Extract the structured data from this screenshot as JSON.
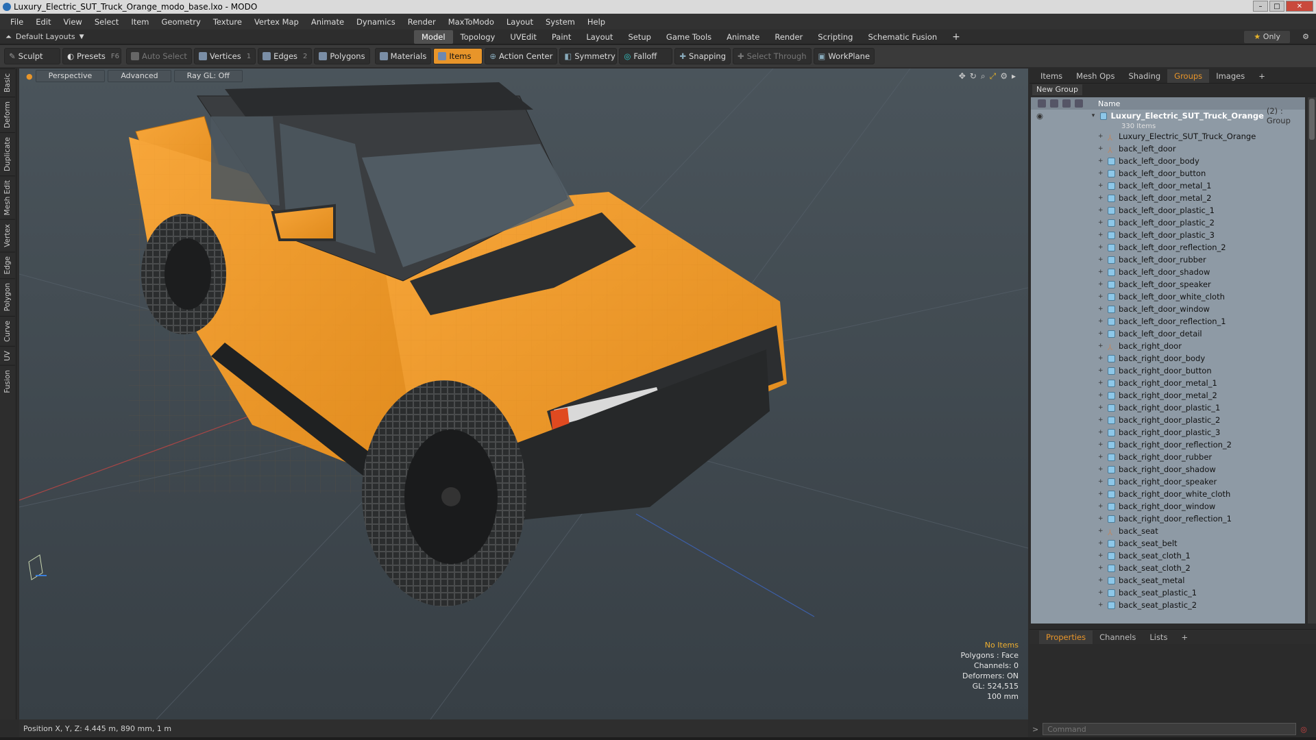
{
  "window": {
    "title": "Luxury_Electric_SUT_Truck_Orange_modo_base.lxo - MODO"
  },
  "menu": [
    "File",
    "Edit",
    "View",
    "Select",
    "Item",
    "Geometry",
    "Texture",
    "Vertex Map",
    "Animate",
    "Dynamics",
    "Render",
    "MaxToModo",
    "Layout",
    "System",
    "Help"
  ],
  "layout": {
    "selector": "Default Layouts",
    "tabs": [
      "Model",
      "Topology",
      "UVEdit",
      "Paint",
      "Layout",
      "Setup",
      "Game Tools",
      "Animate",
      "Render",
      "Scripting",
      "Schematic Fusion"
    ],
    "active_tab": "Model",
    "only_label": "Only"
  },
  "toolbar": {
    "sculpt": "Sculpt",
    "presets": "Presets",
    "presets_key": "F6",
    "auto_select": "Auto Select",
    "vertices": "Vertices",
    "vertices_key": "1",
    "edges": "Edges",
    "edges_key": "2",
    "polygons": "Polygons",
    "materials": "Materials",
    "items": "Items",
    "action_center": "Action Center",
    "symmetry": "Symmetry",
    "falloff": "Falloff",
    "snapping": "Snapping",
    "select_through": "Select Through",
    "workplane": "WorkPlane"
  },
  "left_tabs": [
    "Basic",
    "Deform",
    "Duplicate",
    "Mesh Edit",
    "Vertex",
    "Edge",
    "Polygon",
    "Curve",
    "UV",
    "Fusion"
  ],
  "viewport": {
    "view": "Perspective",
    "mode": "Advanced",
    "raygl": "Ray GL: Off",
    "stats": {
      "no_items": "No Items",
      "polygons": "Polygons : Face",
      "channels": "Channels: 0",
      "deformers": "Deformers: ON",
      "gl": "GL: 524,515",
      "scale": "100 mm"
    },
    "position": "Position X, Y, Z:   4.445 m, 890 mm, 1 m"
  },
  "right_panel": {
    "tabs": [
      "Items",
      "Mesh Ops",
      "Shading",
      "Groups",
      "Images"
    ],
    "active_tab": "Groups",
    "new_group": "New Group",
    "name_header": "Name",
    "root": {
      "name": "Luxury_Electric_SUT_Truck_Orange",
      "suffix": "(2) : Group",
      "count": "330 Items"
    },
    "items": [
      {
        "name": "Luxury_Electric_SUT_Truck_Orange",
        "kind": "locator"
      },
      {
        "name": "back_left_door",
        "kind": "locator"
      },
      {
        "name": "back_left_door_body",
        "kind": "mesh"
      },
      {
        "name": "back_left_door_button",
        "kind": "mesh"
      },
      {
        "name": "back_left_door_metal_1",
        "kind": "mesh"
      },
      {
        "name": "back_left_door_metal_2",
        "kind": "mesh"
      },
      {
        "name": "back_left_door_plastic_1",
        "kind": "mesh"
      },
      {
        "name": "back_left_door_plastic_2",
        "kind": "mesh"
      },
      {
        "name": "back_left_door_plastic_3",
        "kind": "mesh"
      },
      {
        "name": "back_left_door_reflection_2",
        "kind": "mesh"
      },
      {
        "name": "back_left_door_rubber",
        "kind": "mesh"
      },
      {
        "name": "back_left_door_shadow",
        "kind": "mesh"
      },
      {
        "name": "back_left_door_speaker",
        "kind": "mesh"
      },
      {
        "name": "back_left_door_white_cloth",
        "kind": "mesh"
      },
      {
        "name": "back_left_door_window",
        "kind": "mesh"
      },
      {
        "name": "back_left_door_reflection_1",
        "kind": "mesh"
      },
      {
        "name": "back_left_door_detail",
        "kind": "mesh"
      },
      {
        "name": "back_right_door",
        "kind": "locator"
      },
      {
        "name": "back_right_door_body",
        "kind": "mesh"
      },
      {
        "name": "back_right_door_button",
        "kind": "mesh"
      },
      {
        "name": "back_right_door_metal_1",
        "kind": "mesh"
      },
      {
        "name": "back_right_door_metal_2",
        "kind": "mesh"
      },
      {
        "name": "back_right_door_plastic_1",
        "kind": "mesh"
      },
      {
        "name": "back_right_door_plastic_2",
        "kind": "mesh"
      },
      {
        "name": "back_right_door_plastic_3",
        "kind": "mesh"
      },
      {
        "name": "back_right_door_reflection_2",
        "kind": "mesh"
      },
      {
        "name": "back_right_door_rubber",
        "kind": "mesh"
      },
      {
        "name": "back_right_door_shadow",
        "kind": "mesh"
      },
      {
        "name": "back_right_door_speaker",
        "kind": "mesh"
      },
      {
        "name": "back_right_door_white_cloth",
        "kind": "mesh"
      },
      {
        "name": "back_right_door_window",
        "kind": "mesh"
      },
      {
        "name": "back_right_door_reflection_1",
        "kind": "mesh"
      },
      {
        "name": "back_seat",
        "kind": "locator"
      },
      {
        "name": "back_seat_belt",
        "kind": "mesh"
      },
      {
        "name": "back_seat_cloth_1",
        "kind": "mesh"
      },
      {
        "name": "back_seat_cloth_2",
        "kind": "mesh"
      },
      {
        "name": "back_seat_metal",
        "kind": "mesh"
      },
      {
        "name": "back_seat_plastic_1",
        "kind": "mesh"
      },
      {
        "name": "back_seat_plastic_2",
        "kind": "mesh"
      }
    ],
    "bottom_tabs": [
      "Properties",
      "Channels",
      "Lists"
    ],
    "bottom_active": "Properties",
    "command_placeholder": "Command"
  },
  "colors": {
    "accent": "#e8952a",
    "truck": "#f29a2a",
    "viewport": "#3e474d"
  }
}
